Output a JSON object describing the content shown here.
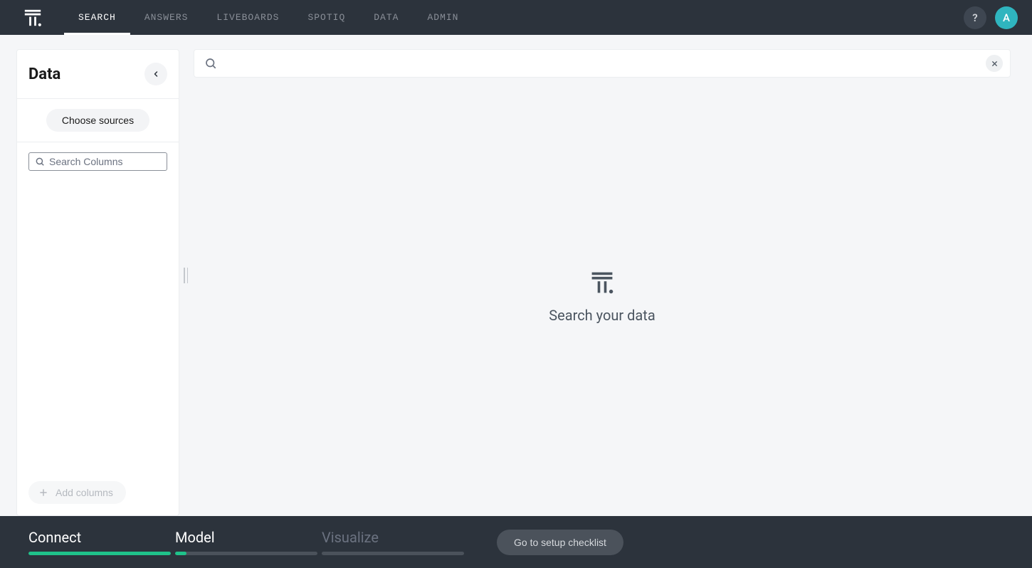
{
  "nav": {
    "tabs": [
      {
        "label": "SEARCH",
        "active": true
      },
      {
        "label": "ANSWERS",
        "active": false
      },
      {
        "label": "LIVEBOARDS",
        "active": false
      },
      {
        "label": "SPOTIQ",
        "active": false
      },
      {
        "label": "DATA",
        "active": false
      },
      {
        "label": "ADMIN",
        "active": false
      }
    ],
    "help_label": "?",
    "avatar_initial": "A"
  },
  "sidebar": {
    "title": "Data",
    "choose_sources_label": "Choose sources",
    "column_search_placeholder": "Search Columns",
    "add_columns_label": "Add columns"
  },
  "search": {
    "value": "",
    "placeholder": ""
  },
  "empty": {
    "heading": "Search your data"
  },
  "footer": {
    "steps": [
      {
        "label": "Connect",
        "progress": 100,
        "dim": false
      },
      {
        "label": "Model",
        "progress": 8,
        "dim": false
      },
      {
        "label": "Visualize",
        "progress": 0,
        "dim": true
      }
    ],
    "setup_label": "Go to setup checklist"
  }
}
